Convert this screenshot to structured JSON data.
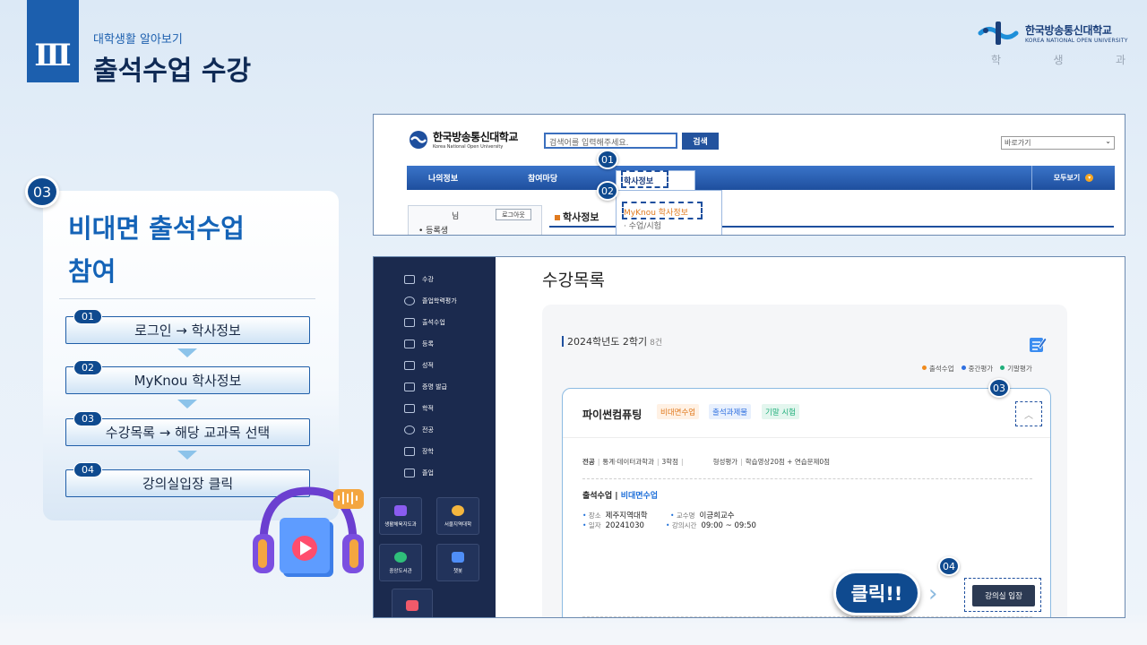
{
  "header": {
    "roman": "Ⅲ",
    "subtitle": "대학생활 알아보기",
    "title": "출석수업 수강"
  },
  "logo": {
    "name_ko": "한국방송통신대학교",
    "name_en": "KOREA NATIONAL OPEN UNIVERSITY",
    "dept": [
      "학",
      "생",
      "과"
    ]
  },
  "card": {
    "badge": "03",
    "title_line1": "비대면 출석수업",
    "title_line2": "참여",
    "steps": [
      {
        "num": "01",
        "label": "로그인 → 학사정보"
      },
      {
        "num": "02",
        "label": "MyKnou 학사정보"
      },
      {
        "num": "03",
        "label": "수강목록 → 해당 교과목 선택"
      },
      {
        "num": "04",
        "label": "강의실입장 클릭"
      }
    ]
  },
  "shot1": {
    "logo_name": "한국방송통신대학교",
    "logo_en": "Korea National Open University",
    "search_placeholder": "검색어를 입력해주세요.",
    "search_button": "검색",
    "quick_select": "바로가기",
    "nav": [
      "나의정보",
      "참여마당",
      "학사정보"
    ],
    "all_view": "모두보기",
    "dropdown": [
      "MyKnou 학사정보",
      "수업/시험"
    ],
    "user_suffix": "님",
    "logout": "로그아웃",
    "registered": "등록생",
    "section": "학사정보"
  },
  "shot2": {
    "sidebar_menu": [
      "수강",
      "졸업학력평가",
      "출석수업",
      "등록",
      "성적",
      "증명 발급",
      "학적",
      "전공",
      "장학",
      "졸업"
    ],
    "tiles": [
      "생활체육지도과",
      "서울지역대학",
      "중앙도서관",
      "챗봇",
      ""
    ],
    "page_title": "수강목록",
    "term": "2024학년도 2학기",
    "term_count": "8건",
    "legend": [
      "출석수업",
      "중간평가",
      "기말평가"
    ],
    "course": {
      "name": "파이썬컴퓨팅",
      "tags": [
        "비대면수업",
        "출석과제물",
        "기말 시험"
      ],
      "info_major_k": "전공",
      "info_major_v": "통계·데이터과학과",
      "info_credit": "3학점",
      "info_eval": "형성평가",
      "info_eval_v": "학습영상20점 + 연습문제0점",
      "att_title": "출석수업",
      "att_type": "비대면수업",
      "place_k": "장소",
      "place_v": "제주지역대학",
      "prof_k": "교수명",
      "prof_v": "이긍희교수",
      "date_k": "일자",
      "date_v": "20241030",
      "time_k": "강의시간",
      "time_v": "09:00 ~ 09:50",
      "enter_button": "강의실 입장"
    }
  },
  "callouts": {
    "n01": "01",
    "n02": "02",
    "n03": "03",
    "n04": "04",
    "click": "클릭!!"
  },
  "colors": {
    "primary": "#1c5fae",
    "navy": "#0f4a8f",
    "sidebar": "#1b2a4e",
    "orange": "#e07a1f",
    "legend_orange": "#f08a1c",
    "legend_blue": "#2e6fe0",
    "legend_green": "#1fae7a"
  }
}
